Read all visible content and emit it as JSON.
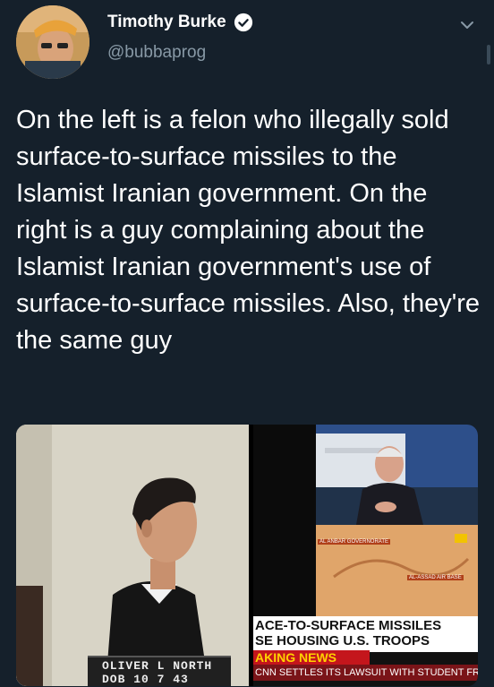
{
  "author": {
    "name": "Timothy Burke",
    "handle": "@bubbaprog",
    "verified": true
  },
  "icons": {
    "verified": "verified-badge-icon",
    "menu": "chevron-down-icon"
  },
  "tweet": {
    "text": "On the left is a felon who illegally sold surface-to-surface missiles to the Islamist Iranian government. On the right is a guy complaining about the Islamist Iranian government's use of surface-to-surface missiles. Also, they're the same guy"
  },
  "media": {
    "left": {
      "placard_line1": "OLIVER L NORTH",
      "placard_line2": "DOB 10 7 43"
    },
    "right": {
      "map_label_1": "AL ANBAR GOVERNORATE",
      "map_label_2": "AL-ASSAD AIR BASE",
      "chyron_line1": "ACE-TO-SURFACE MISSILES",
      "chyron_line2": "SE HOUSING U.S. TROOPS",
      "breaking": "AKING NEWS",
      "ticker": "CNN SETTLES ITS LAWSUIT WITH STUDENT FROM CO"
    }
  },
  "colors": {
    "background": "#15202b",
    "secondary_text": "#8899a6",
    "breaking_red": "#c4161c",
    "breaking_yellow": "#ffd200"
  }
}
